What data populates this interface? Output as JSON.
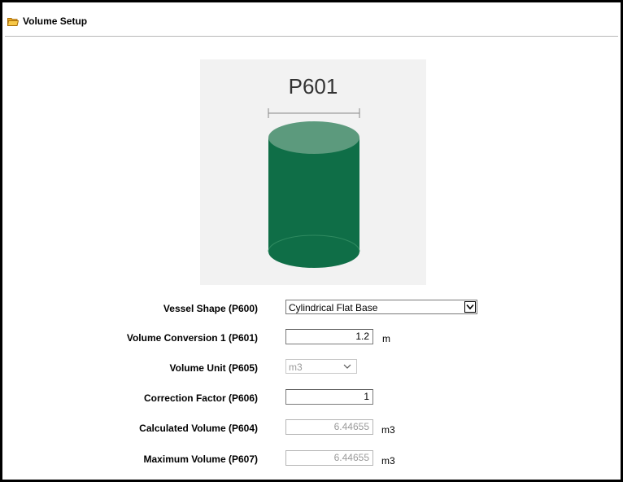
{
  "header": {
    "title": "Volume Setup",
    "icon": "folder-icon"
  },
  "diagram": {
    "dimension_label": "P601",
    "tank_color": "#0f6e47",
    "tank_top_color": "#5c9a7d"
  },
  "form": {
    "vessel_shape": {
      "label": "Vessel Shape (P600)",
      "value": "Cylindrical Flat Base"
    },
    "volume_conversion": {
      "label": "Volume Conversion 1 (P601)",
      "value": "1.2",
      "unit": "m"
    },
    "volume_unit": {
      "label": "Volume Unit (P605)",
      "value": "m3"
    },
    "correction_factor": {
      "label": "Correction Factor (P606)",
      "value": "1"
    },
    "calculated_volume": {
      "label": "Calculated Volume (P604)",
      "value": "6.44655",
      "unit": "m3"
    },
    "maximum_volume": {
      "label": "Maximum Volume (P607)",
      "value": "6.44655",
      "unit": "m3"
    }
  }
}
